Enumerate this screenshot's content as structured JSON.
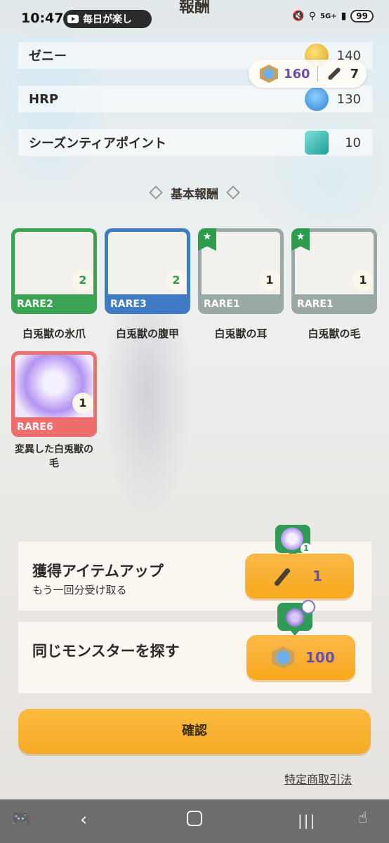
{
  "status_bar": {
    "time": "10:47",
    "notification_text": "毎日が楽し",
    "network": "5G+",
    "battery": "99"
  },
  "header": {
    "title": "報酬"
  },
  "currency": {
    "paw_value": "160",
    "knife_value": "7"
  },
  "rewards": [
    {
      "label": "ゼニー",
      "value": "140",
      "icon": "zenny-coin-icon"
    },
    {
      "label": "HRP",
      "value": "130",
      "icon": "hrp-emblem-icon"
    },
    {
      "label": "シーズンティアポイント",
      "value": "10",
      "icon": "season-tier-icon"
    }
  ],
  "section": {
    "title": "基本報酬"
  },
  "items": [
    {
      "rarity": "RARE2",
      "name": "白兎獣の氷爪",
      "qty": "2",
      "color": "#3aa453"
    },
    {
      "rarity": "RARE3",
      "name": "白兎獣の腹甲",
      "qty": "2",
      "color": "#3f7bc4"
    },
    {
      "rarity": "RARE1",
      "name": "白兎獣の耳",
      "qty": "1",
      "color": "#9aa8a6",
      "starred": true
    },
    {
      "rarity": "RARE1",
      "name": "白兎獣の毛",
      "qty": "1",
      "color": "#9aa8a6",
      "starred": true
    },
    {
      "rarity": "RARE6",
      "name_line1": "変異した白兎獣の",
      "name_line2": "毛",
      "qty": "1",
      "color": "#ee6e6e"
    }
  ],
  "bonus": {
    "title": "獲得アイテムアップ",
    "subtitle": "もう一回分受け取る",
    "cost": "1",
    "badge_qty": "1"
  },
  "search": {
    "title": "同じモンスターを探す",
    "cost": "100"
  },
  "confirm_label": "確認",
  "legal_link": "特定商取引法",
  "colors": {
    "accent_orange": "#f7a91c",
    "green": "#2f9b57",
    "purple_text": "#6d4fb0"
  }
}
